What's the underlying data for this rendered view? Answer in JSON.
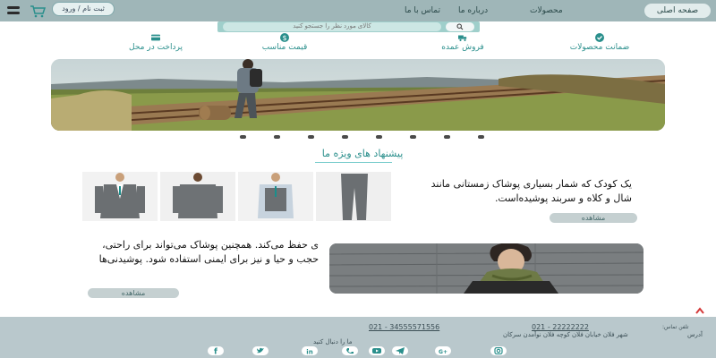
{
  "header": {
    "nav_home": "صفحه اصلی",
    "nav_products": "محصولات",
    "nav_about": "درباره ما",
    "nav_contact": "تماس با ما",
    "login_label": "ثبت نام / ورود"
  },
  "search": {
    "placeholder": "کالای مورد نظر را جستجو کنید"
  },
  "features": {
    "f1": "ضمانت محصولات",
    "f2": "فروش عمده",
    "f3": "قیمت مناسب",
    "f4": "پرداخت در محل"
  },
  "section_title": "پیشنهاد های ویژه ما",
  "product1": {
    "description": "یک کودک که شمار بسیاری پوشاک زمستانی مانند شال و کلاه و سربند پوشیده‌است.",
    "button": "مشاهده"
  },
  "product2": {
    "description": "ی حفظ می‌کند. همچنین پوشاک می‌تواند برای راحتی، حجب و حیا و نیز برای ایمنی استفاده شود. پوشیدنی‌ها",
    "button": "مشاهده"
  },
  "footer": {
    "phone_label": "تلفن تماس:",
    "phone1": "021 - 22222222",
    "phone2": "021 - 34555571556",
    "address_label": "آدرس",
    "address": "شهر فلان خیابان فلان کوچه فلان نوآمدن سرکان",
    "follow": "ما را دنبال کنید"
  },
  "colors": {
    "accent": "#2a8f8c",
    "topbar": "#9fb6b8",
    "footer": "#b9c8cc"
  }
}
